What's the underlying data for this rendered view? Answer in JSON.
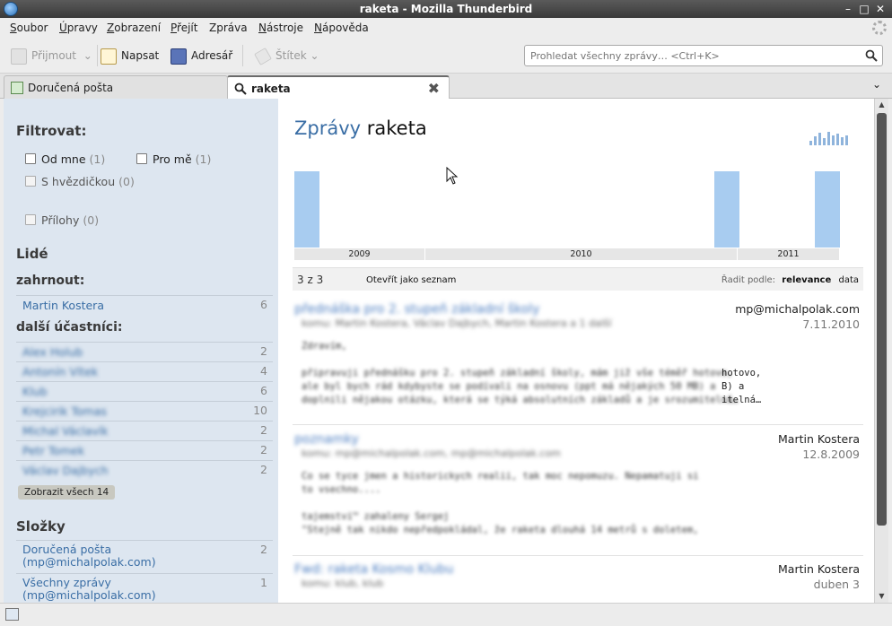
{
  "window": {
    "title": "raketa - Mozilla Thunderbird",
    "controls": [
      "minimize",
      "maximize",
      "close"
    ]
  },
  "menubar": {
    "items": [
      {
        "first": "S",
        "rest": "oubor"
      },
      {
        "first": "Ú",
        "rest": "pravy"
      },
      {
        "first": "Z",
        "rest": "obrazení"
      },
      {
        "first": "P",
        "rest": "řejít"
      },
      {
        "first": "",
        "rest": "Zpráva"
      },
      {
        "first": "N",
        "rest": "ástroje"
      },
      {
        "first": "N",
        "rest": "ápověda"
      }
    ]
  },
  "toolbar": {
    "receive_label": "Přijmout",
    "write_label": "Napsat",
    "addressbook_label": "Adresář",
    "tag_label": "Štítek",
    "search_placeholder": "Prohledat všechny zprávy… <Ctrl+K>"
  },
  "tabs": [
    {
      "label": "Doručená pošta",
      "icon": "inbox-icon"
    },
    {
      "label": "raketa",
      "icon": "search-icon"
    }
  ],
  "sidebar": {
    "filter_heading": "Filtrovat:",
    "filters": [
      {
        "label": "Od mne",
        "count": "(1)"
      },
      {
        "label": "Pro mě",
        "count": "(1)"
      },
      {
        "label": "S hvězdičkou",
        "count": "(0)"
      },
      {
        "label": "Přílohy",
        "count": "(0)"
      }
    ],
    "people_heading": "Lidé",
    "include_heading": "zahrnout:",
    "included": [
      {
        "name": "Martin Kostera",
        "count": "6"
      }
    ],
    "other_heading": "další účastníci:",
    "others": [
      {
        "name": "Alex Holub",
        "count": "2"
      },
      {
        "name": "Antonín Vítek",
        "count": "4"
      },
      {
        "name": "Klub",
        "count": "6"
      },
      {
        "name": "Krejcirik Tomas",
        "count": "10"
      },
      {
        "name": "Michal Václavík",
        "count": "2"
      },
      {
        "name": "Petr Tomek",
        "count": "2"
      },
      {
        "name": "Václav Dajbych",
        "count": "2"
      }
    ],
    "show_all_label": "Zobrazit všech 14",
    "folders_heading": "Složky",
    "folders": [
      {
        "line1": "Doručená pošta",
        "line2": "(mp@michalpolak.com)",
        "count": "2"
      },
      {
        "line1": "Všechny zprávy",
        "line2": "(mp@michalpolak.com)",
        "count": "1"
      }
    ]
  },
  "main": {
    "title_prefix": "Zprávy",
    "title_query": "raketa",
    "results_count": "3 z 3",
    "open_as_list": "Otevřít jako seznam",
    "sort_label": "Řadit podle:",
    "sort_relevance": "relevance",
    "sort_date": "data",
    "messages": [
      {
        "subject": "přednáška pro 2. stupeň základní školy",
        "from": "mp@michalpolak.com",
        "date": "7.11.2010",
        "to": "komu: Martin Kostera, Václav Dajbych, Martin Kostera a 1 další",
        "snippet": "Zdravím,\n\npřipravuji přednášku pro 2. stupeň základní školy, mám již vše téměř hotovo,\nale byl bych rád kdybyste se podívali na osnovu (ppt má nějakých 50 MB) a\ndoplnili nějakou otázku, která se týká absolutních základů a je srozumitelná…",
        "snippet_tail": "hotovo,\nB) a\nitelná…"
      },
      {
        "subject": "poznamky",
        "from": "Martin Kostera",
        "date": "12.8.2009",
        "to": "komu: mp@michalpolak.com, mp@michalpolak.com",
        "snippet": "Co se tyce jmen a historickych realii, tak moc nepomuzu. Nepamatuji si\nto vsechno....\n\ntajemstvi™ zahaleny Sergej\n\"Stejně tak nikdo nepředpokládal, že raketa dlouhá 14 metrů s doletem,"
      },
      {
        "subject": "Fwd: raketa Kosmo Klubu",
        "from": "Martin Kostera",
        "date": "duben 3",
        "to": "komu: klub, klub"
      }
    ]
  },
  "chart_data": {
    "type": "bar",
    "categories": [
      "2009",
      "2010",
      "2011"
    ],
    "bars_by_month": [
      1,
      0,
      0,
      0,
      0,
      0,
      0,
      0,
      0,
      0,
      0,
      0,
      0,
      0,
      0,
      0,
      0,
      0,
      0,
      0,
      0,
      1,
      0,
      0,
      0,
      0,
      1
    ],
    "ylim": [
      0,
      1
    ]
  },
  "colors": {
    "accent": "#3a6ea5",
    "sidebar_bg": "#dde6f0",
    "timeline_bar": "#a8ccf0"
  }
}
